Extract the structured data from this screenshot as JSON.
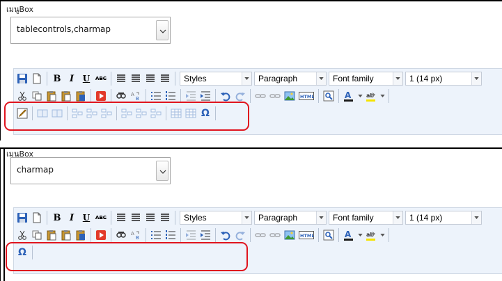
{
  "panels": [
    {
      "label": "เมนูBox",
      "select_value": "tablecontrols,charmap",
      "dropdowns": {
        "styles": "Styles",
        "paragraph": "Paragraph",
        "font_family": "Font family",
        "font_size": "1 (14 px)"
      },
      "omega": "Ω"
    },
    {
      "label": "เมนูBox",
      "select_value": "charmap",
      "dropdowns": {
        "styles": "Styles",
        "paragraph": "Paragraph",
        "font_family": "Font family",
        "font_size": "1 (14 px)"
      },
      "omega": "Ω"
    }
  ],
  "colors": {
    "highlight": "#e0141e",
    "toolbar_bg": "#edf3fb"
  },
  "icons": [
    "save-icon",
    "new-document-icon",
    "bold-icon",
    "italic-icon",
    "underline-icon",
    "strikethrough-icon",
    "align-left-icon",
    "align-center-icon",
    "align-right-icon",
    "align-justify-icon",
    "cut-icon",
    "copy-icon",
    "paste-icon",
    "paste-text-icon",
    "paste-word-icon",
    "media-icon",
    "find-icon",
    "replace-icon",
    "bullet-list-icon",
    "numbered-list-icon",
    "outdent-icon",
    "indent-icon",
    "undo-icon",
    "redo-icon",
    "link-icon",
    "unlink-icon",
    "image-icon",
    "html-icon",
    "preview-icon",
    "text-color-icon",
    "highlight-color-icon",
    "table-icon",
    "charmap-icon"
  ]
}
